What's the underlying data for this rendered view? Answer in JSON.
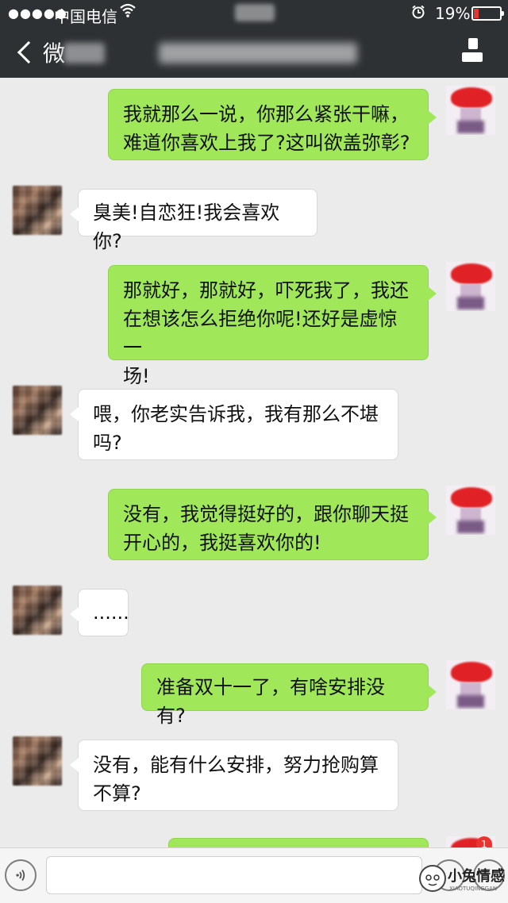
{
  "status_bar": {
    "signal": "●●●●●",
    "carrier": "中国电信",
    "wifi_icon": "wifi-icon",
    "alarm_icon": "alarm-icon",
    "battery_percent": "19%",
    "battery_level": 0.19
  },
  "nav": {
    "back_label": "微",
    "back_icon": "chevron-left-icon",
    "contact_icon": "person-icon"
  },
  "messages": [
    {
      "side": "right",
      "text": "我就那么一说，你那么紧张干嘛，\n难道你喜欢上我了?这叫欲盖弥彰?"
    },
    {
      "side": "left",
      "text": "臭美!自恋狂!我会喜欢你?"
    },
    {
      "side": "right",
      "text": "那就好，那就好，吓死我了，我还\n在想该怎么拒绝你呢!还好是虚惊一\n场!"
    },
    {
      "side": "left",
      "text": "喂，你老实告诉我，我有那么不堪\n吗?"
    },
    {
      "side": "right",
      "text": "没有，我觉得挺好的，跟你聊天挺\n开心的，我挺喜欢你的!"
    },
    {
      "side": "left",
      "text": "......"
    },
    {
      "side": "right",
      "text": "准备双十一了，有啥安排没有?"
    },
    {
      "side": "left",
      "text": "没有，能有什么安排，努力抢购算\n不算?"
    },
    {
      "side": "right",
      "text": ""
    }
  ],
  "notification_badge": "1",
  "input_bar": {
    "voice_icon": "voice-icon",
    "emoji_icon": "emoji-icon",
    "plus_icon": "plus-icon"
  },
  "watermark": {
    "title": "小兔情感",
    "subtitle": "XIAOTUQINGGAN"
  }
}
